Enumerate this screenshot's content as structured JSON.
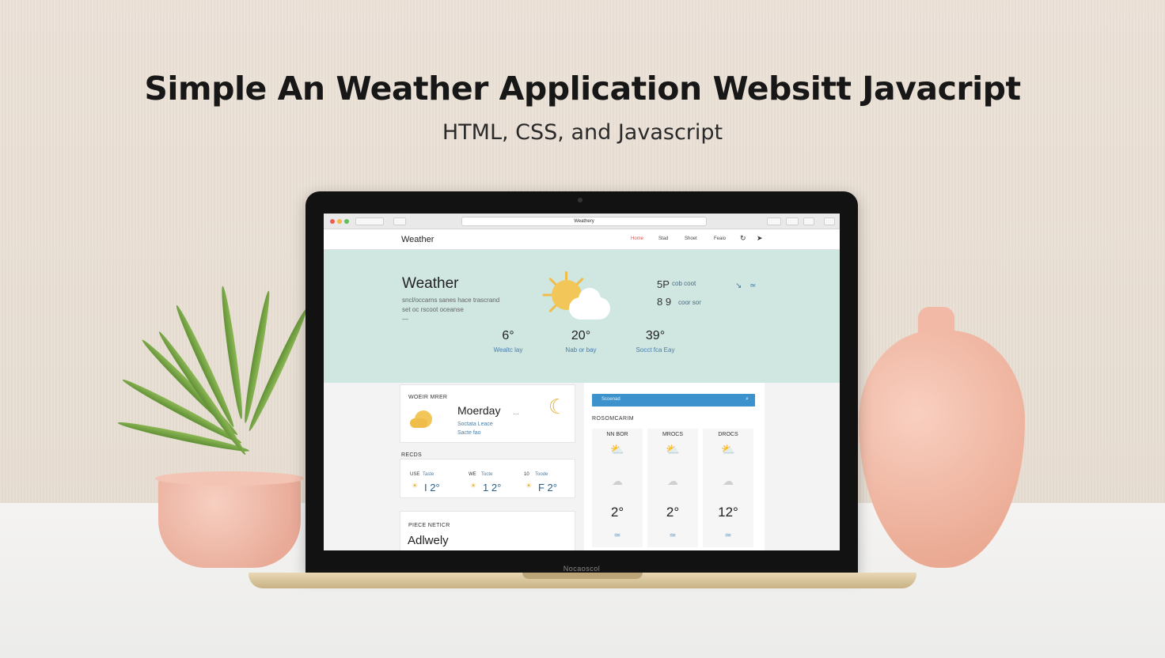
{
  "poster": {
    "title": "Simple An Weather Application Websitt Javacript",
    "subtitle": "HTML, CSS, and Javascript"
  },
  "laptop": {
    "brand": "Nocaoscol"
  },
  "browser": {
    "url": "Weathery"
  },
  "site": {
    "logo": "Weather",
    "nav": [
      {
        "label": "Home"
      },
      {
        "label": "Stad"
      },
      {
        "label": "Shoet"
      },
      {
        "label": "Feaio"
      }
    ]
  },
  "hero": {
    "title": "Weather",
    "description_line1": "sncl/occarns sanes hace trascrand",
    "description_line2": "set oc rscoot oceanse",
    "description_line3": "—",
    "stat1_value": "5P",
    "stat1_text": "cob coot",
    "stat2_value": "8 9",
    "stat2_text": "coor sor",
    "temps": [
      {
        "value": "6°",
        "label": "Wealtc lay"
      },
      {
        "value": "20°",
        "label": "Nab or bay"
      },
      {
        "value": "39°",
        "label": "Socct fca Eay"
      }
    ]
  },
  "today": {
    "label": "WOEIR MRER",
    "day": "Moerday",
    "suffix": "…",
    "desc_line1": "Soctata Leace",
    "desc_line2": "Sacte fao"
  },
  "hourly": {
    "label": "RECDS",
    "items": [
      {
        "time": "USE",
        "time2": "Taste",
        "value": "I 2°"
      },
      {
        "time": "WE",
        "time2": "Tocte",
        "value": "1 2°"
      },
      {
        "time": "10",
        "time2": "Toode",
        "value": "F 2°"
      }
    ]
  },
  "activity": {
    "label": "PIECE NETICR",
    "value": "Adlwely"
  },
  "forecast": {
    "search_placeholder": "Scoenad",
    "search_icon": "search-icon",
    "heading": "ROSOMCARIM",
    "days": [
      {
        "name": "NN BOR",
        "temp": "2°"
      },
      {
        "name": "MROCS",
        "temp": "2°"
      },
      {
        "name": "DROCS",
        "temp": "12°"
      }
    ]
  },
  "colors": {
    "hero_bg": "#cfe6e1",
    "accent_blue": "#3c92cc",
    "nav_active": "#d9534f",
    "sun": "#f3c65a"
  }
}
